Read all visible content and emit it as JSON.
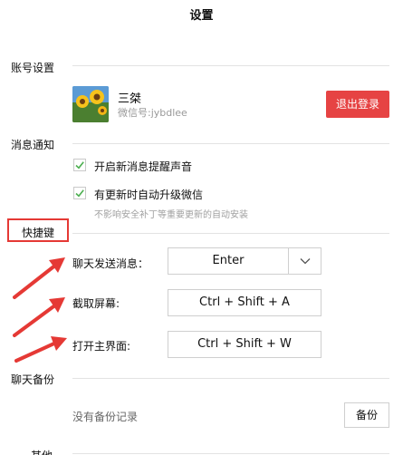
{
  "window": {
    "title": "设置"
  },
  "account": {
    "section_label": "账号设置",
    "nickname": "三桀",
    "wechat_id": "微信号:jybdlee",
    "logout_label": "退出登录"
  },
  "notifications": {
    "section_label": "消息通知",
    "options": [
      {
        "label": "开启新消息提醒声音",
        "checked": true
      },
      {
        "label": "有更新时自动升级微信",
        "checked": true
      }
    ],
    "hint": "不影响安全补丁等重要更新的自动安装"
  },
  "shortcuts": {
    "section_label": "快捷键",
    "items": [
      {
        "label": "聊天发送消息：",
        "value": "Enter"
      },
      {
        "label": "截取屏幕:",
        "value": "Ctrl + Shift + A"
      },
      {
        "label": "打开主界面:",
        "value": "Ctrl + Shift + W"
      }
    ]
  },
  "backup": {
    "section_label": "聊天备份",
    "empty_text": "没有备份记录",
    "button_label": "备份"
  },
  "other": {
    "section_label": "其他"
  },
  "colors": {
    "accent_red": "#e64343",
    "check_green": "#4caf50",
    "annotation_red": "#e53935"
  }
}
